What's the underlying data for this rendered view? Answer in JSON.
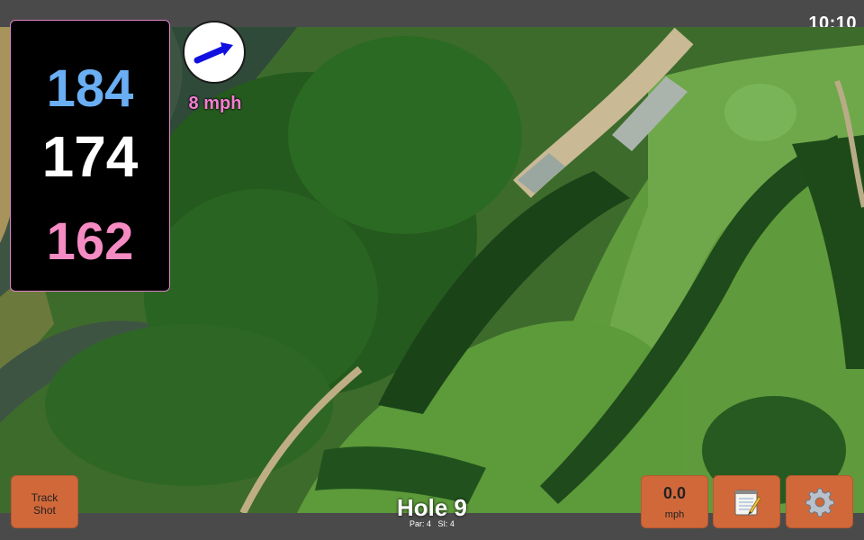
{
  "status": {
    "time": "10:10"
  },
  "distances": {
    "back": "184",
    "middle": "174",
    "front": "162"
  },
  "wind": {
    "speed_label": "8 mph",
    "arrow_color": "#1010e0"
  },
  "track_shot": {
    "line1": "Track",
    "line2": "Shot"
  },
  "hole": {
    "title": "Hole 9",
    "par": "Par: 4",
    "si": "SI: 4"
  },
  "speed": {
    "value": "0.0",
    "unit": "mph"
  },
  "toolbar": {
    "notes_icon": "notepad-icon",
    "settings_icon": "gear-icon"
  },
  "colors": {
    "accent_button": "#d1683a",
    "back_distance": "#6aaef3",
    "middle_distance": "#ffffff",
    "front_distance": "#f58bc3",
    "wind_text": "#f47ed3"
  }
}
